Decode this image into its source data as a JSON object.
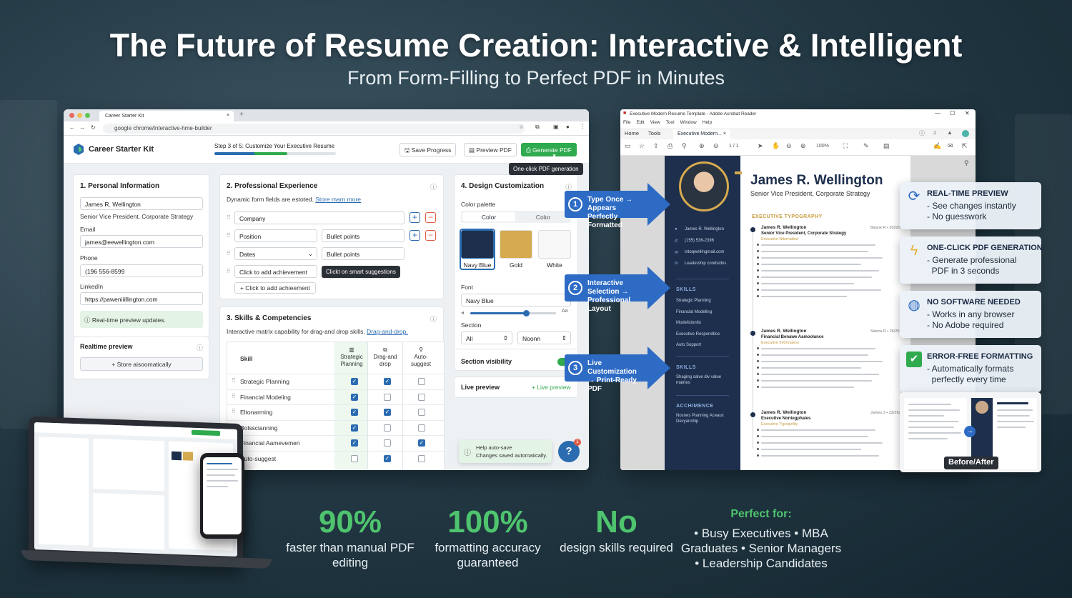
{
  "headline": {
    "title": "The Future of Resume Creation: Interactive & Intelligent",
    "subtitle": "From Form-Filling to Perfect PDF in Minutes"
  },
  "browser": {
    "tab_title": "Career Starter Kit",
    "url": "google chrome/interactive-hme-builder",
    "brand": "Career Starter Kit",
    "step": "Step 3 of 5: Customize Your Executive Resume",
    "progress": 0.6,
    "save": "Save Progress",
    "preview": "Preview PDF",
    "generate": "Generate PDF",
    "generate_tooltip": "One-click PDF generation",
    "personal": {
      "title": "1. Personal Information",
      "name": "James R. Wellington",
      "role": "Senior Vice President, Corporate Strategy",
      "email_label": "Email",
      "email": "james@eewellington.com",
      "phone_label": "Phone",
      "phone": "(196 556-8599",
      "linkedin_label": "LinkedIn",
      "linkedin": "https://paweniiillington.com",
      "note": "Real-time preview updates.",
      "realtime_label": "Realtime preview",
      "store": "Store aisoomatically"
    },
    "experience": {
      "title": "2. Professional Experience",
      "desc": "Dynamic form fields are estoted.",
      "link": "Store marn more",
      "company": "Company",
      "position": "Position",
      "bullets1": "Bullet points",
      "dates": "Dates",
      "bullets2": "Bullet points",
      "achievement": "Click to add achievement",
      "tooltip": "Clickt on smart suggestions",
      "add": "Click to add achieement"
    },
    "skills": {
      "title": "3. Skills & Competencies",
      "desc": "Interactive matrix capability for drag-and drop skills.",
      "link": "Drag-and-drop.",
      "col_skill": "Skill",
      "cols": [
        "Strategic Planning",
        "Drag-and drop",
        "Auto-suggest"
      ],
      "rows": [
        {
          "name": "Strategic Planning",
          "checks": [
            true,
            true,
            false
          ]
        },
        {
          "name": "Financial Modeling",
          "checks": [
            true,
            false,
            false
          ]
        },
        {
          "name": "Eltonarming",
          "checks": [
            true,
            true,
            false
          ]
        },
        {
          "name": "Bolsscianning",
          "checks": [
            true,
            false,
            false
          ]
        },
        {
          "name": "Financial Aamevemen",
          "checks": [
            true,
            false,
            true
          ]
        },
        {
          "name": "Auto-suggest",
          "checks": [
            false,
            true,
            false
          ]
        }
      ]
    },
    "design": {
      "title": "4. Design Customization",
      "palette_label": "Color palette",
      "tab1": "Color",
      "tab2": "Color",
      "swatches": [
        {
          "name": "Navy Blue",
          "color": "#1d2f4d"
        },
        {
          "name": "Gold",
          "color": "#d6aa4f"
        },
        {
          "name": "White",
          "color": "#f8f8f8"
        }
      ],
      "font_label": "Font",
      "font": "Navy Blue",
      "slider_end": "Aa",
      "slider_value": 0.65,
      "section_label": "Section",
      "sec1": "All",
      "sec2": "Noonn",
      "visibility": "Section visibility",
      "live": "Live preview",
      "live_link": "+ Live preview",
      "autosave_title": "Help auto-save",
      "autosave_desc": "Changes saved automatically.",
      "help": "?",
      "badge": "1"
    }
  },
  "acrobat": {
    "title": "Executive Modern Resume Template - Adobe Acrobat Reader",
    "menu": [
      "File",
      "Edit",
      "View",
      "Tool",
      "Window",
      "Help"
    ],
    "tabs": [
      "Home",
      "Tools",
      "Executive Modern..."
    ],
    "page": "1 / 1",
    "zoom": "100%",
    "resume": {
      "name": "James R. Wellington",
      "title": "Senior Vice President, Corporate Strategy",
      "section": "EXECUTIVE TYPOGRAPHY",
      "contact": [
        "James R. Wellington",
        "(155) 536-2396",
        "intoqwellingmail.com",
        "Leadership condsidns"
      ],
      "skills_h": "SKILLS",
      "skills": [
        "Strategic Planning",
        "Financial Modeling",
        "Modelisiontio",
        "Executive Respondtice",
        "Auto Support"
      ],
      "skills2_h": "SKILLS",
      "skills2": "Shaging salve div value matries",
      "ach_h": "ACCHIMENCE",
      "ach": "Nosnes Planning Aceaux Devyanship",
      "jobs": [
        {
          "name": "James R. Wellington",
          "role": "Senior Vice President, Corporate Strategy",
          "sub": "Executive Nitomatted",
          "date": "Baane R • 2022004"
        },
        {
          "name": "James R. Wellington",
          "role": "Financial Benawe Aamoolance",
          "sub": "Executive Information",
          "date": "Setera R • 26/2023"
        },
        {
          "name": "James R. Wellington",
          "role": "Executive Nontegphales",
          "sub": "Executive Typogoility",
          "date": "James 3 • 22/2629"
        }
      ]
    }
  },
  "callouts": [
    {
      "num": "1",
      "text": "Type Once → Appears Perfectly Formatted"
    },
    {
      "num": "2",
      "text": "Interactive Selection → Professional Layout"
    },
    {
      "num": "3",
      "text": "Live Customization → Print-Ready PDF"
    }
  ],
  "features": [
    {
      "icon": "refresh-icon",
      "title": "REAL-TIME PREVIEW",
      "lines": [
        "- See changes instantly",
        "- No guesswork"
      ]
    },
    {
      "icon": "lightning-icon",
      "title": "ONE-CLICK PDF GENERATION",
      "lines": [
        "- Generate professional",
        "  PDF in 3 seconds"
      ]
    },
    {
      "icon": "globe-icon",
      "title": "NO SOFTWARE NEEDED",
      "lines": [
        "- Works in any browser",
        "- No Adobe required"
      ]
    },
    {
      "icon": "check-icon",
      "title": "ERROR-FREE FORMATTING",
      "lines": [
        "- Automatically formats",
        "  perfectly every time"
      ]
    }
  ],
  "before_after": "Before/After",
  "stats": [
    {
      "value": "90%",
      "desc": "faster than manual PDF editing"
    },
    {
      "value": "100%",
      "desc": "formatting accuracy guaranteed"
    },
    {
      "value": "No",
      "desc": "design skills required"
    }
  ],
  "perfect": {
    "title": "Perfect for:",
    "text": "• Busy Executives • MBA Graduates • Senior Managers • Leadership Candidates"
  },
  "colors": {
    "accent_green": "#2faa4e",
    "accent_blue": "#2d6bc4",
    "navy": "#1d2f4d",
    "stat_green": "#4fc46e"
  }
}
